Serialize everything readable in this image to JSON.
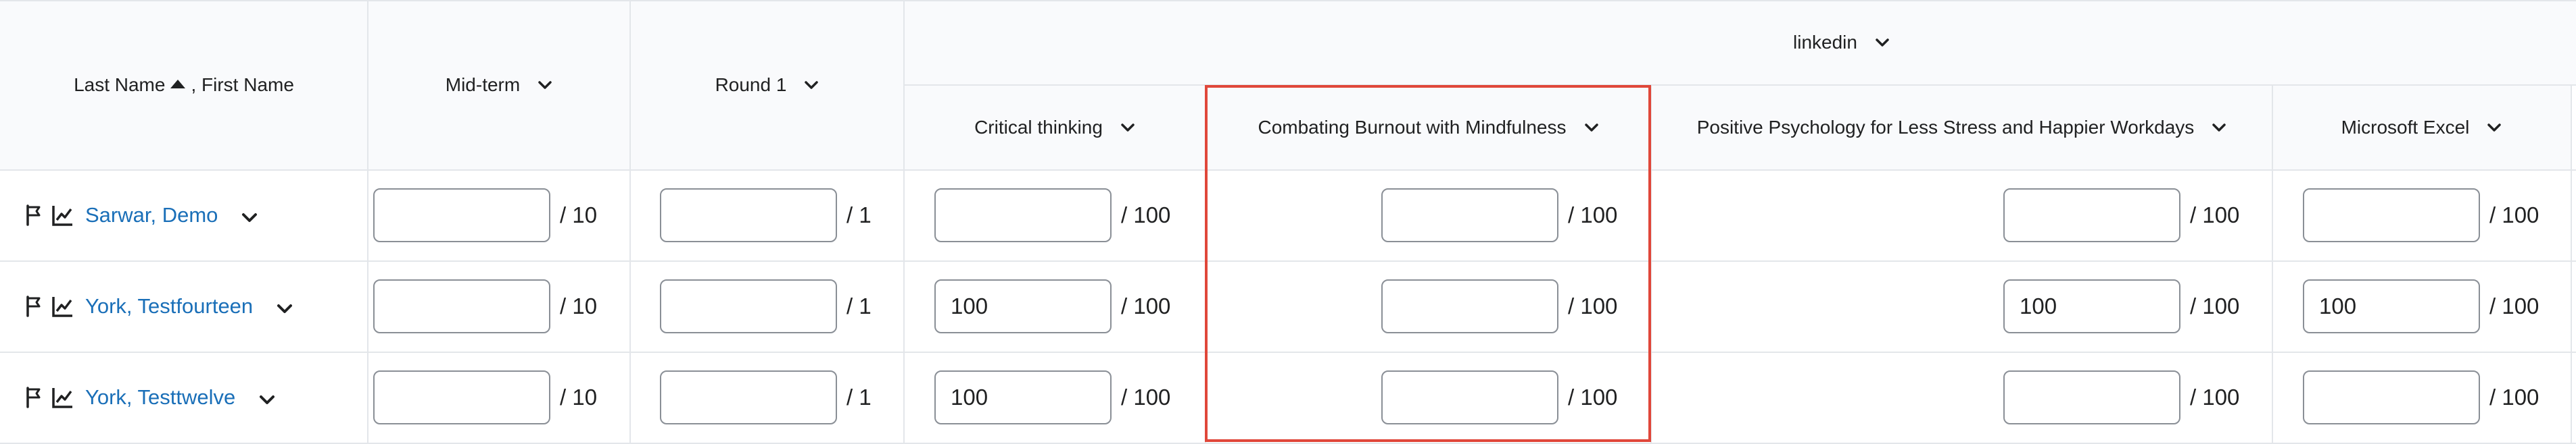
{
  "header": {
    "name_col": {
      "last": "Last Name",
      "first": ", First Name"
    },
    "midterm": "Mid-term",
    "round1": "Round 1",
    "group": "linkedin",
    "sub": [
      "Critical thinking",
      "Combating Burnout with Mindfulness",
      "Positive Psychology for Less Stress and Happier Workdays",
      "Microsoft Excel"
    ]
  },
  "rows": [
    {
      "name": "Sarwar, Demo",
      "midterm": "",
      "round1": "",
      "c1": "",
      "c2": "",
      "c3": "",
      "c4": ""
    },
    {
      "name": "York, Testfourteen",
      "midterm": "",
      "round1": "",
      "c1": "100",
      "c2": "",
      "c3": "100",
      "c4": "100"
    },
    {
      "name": "York, Testtwelve",
      "midterm": "",
      "round1": "",
      "c1": "100",
      "c2": "",
      "c3": "",
      "c4": ""
    }
  ],
  "outof": {
    "midterm": "/ 10",
    "round1": "/ 1",
    "c1": "/ 100",
    "c2": "/ 100",
    "c3": "/ 100",
    "c4": "/ 100"
  },
  "colors": {
    "link": "#1a6fb8",
    "highlight": "#e0473a",
    "header_bg": "#f9fafc",
    "grid": "#e3e6ea"
  }
}
